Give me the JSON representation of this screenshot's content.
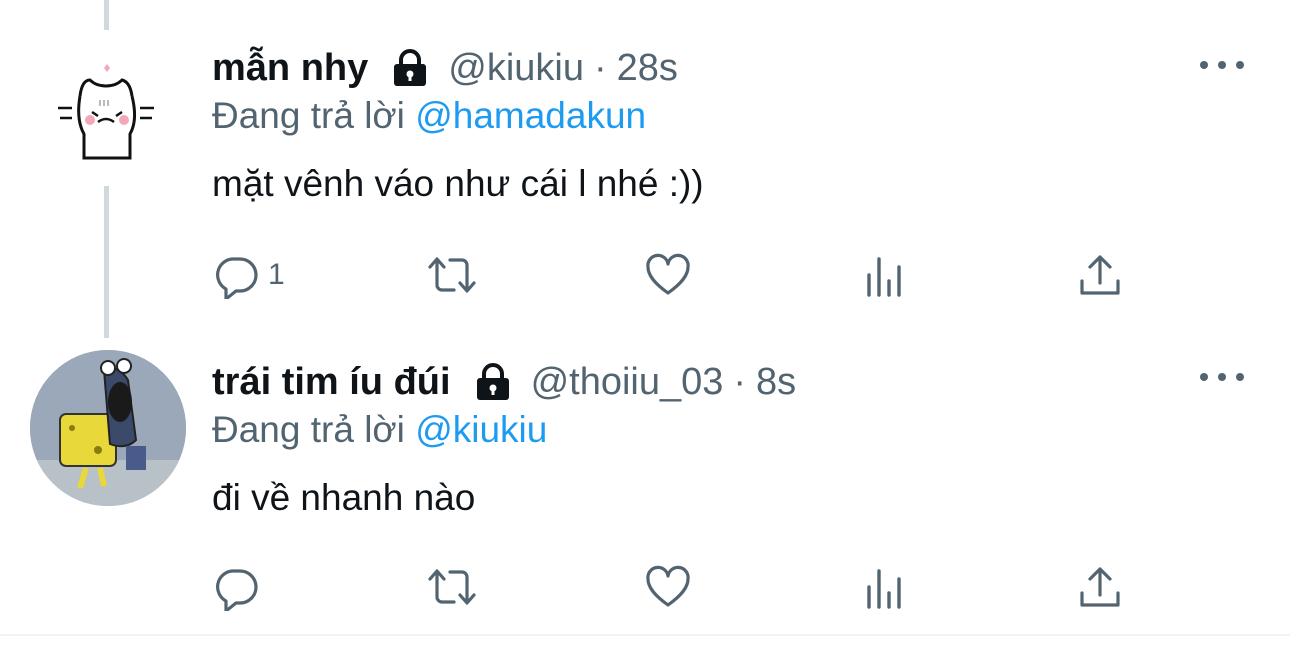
{
  "thread": {
    "tweets": [
      {
        "display_name": "mẫn nhy",
        "handle": "@kiukiu",
        "separator": "·",
        "time": "28s",
        "reply_prefix": "Đang trả lời",
        "reply_to": "@hamadakun",
        "text": "mặt vênh váo như cái l nhé :))",
        "reply_count": "1",
        "avatar": "cat-doodle-avatar"
      },
      {
        "display_name": "trái tim íu đúi",
        "handle": "@thoiiu_03",
        "separator": "·",
        "time": "8s",
        "reply_prefix": "Đang trả lời",
        "reply_to": "@kiukiu",
        "text": "đi về nhanh nào",
        "reply_count": "",
        "avatar": "spongebob-avatar"
      }
    ]
  },
  "icons": {
    "lock": "lock-icon",
    "more": "more-dots-icon",
    "reply": "reply-bubble-icon",
    "retweet": "retweet-icon",
    "like": "heart-icon",
    "views": "views-bars-icon",
    "share": "share-upload-icon"
  },
  "colors": {
    "text": "#0f1419",
    "secondary": "#536471",
    "link": "#1d9bf0",
    "thread_line": "#cfd9de"
  }
}
